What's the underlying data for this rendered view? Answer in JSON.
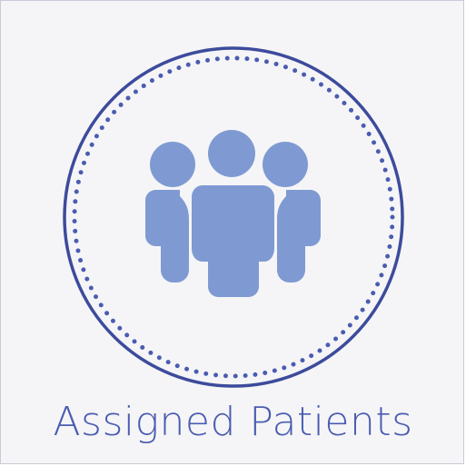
{
  "tile": {
    "label": "Assigned Patients",
    "icon": "patient-group-icon",
    "colors": {
      "background": "#f5f5f7",
      "border": "#c9cbd6",
      "ring": "#3d4b9c",
      "dots": "#4a5cb0",
      "icon_fill": "#7f9ad2",
      "label": "#4a5cb0"
    }
  }
}
